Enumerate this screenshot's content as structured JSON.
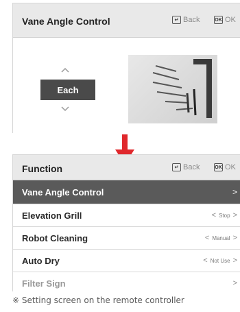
{
  "top_screen": {
    "title": "Vane Angle Control",
    "back_label": "Back",
    "ok_label": "OK",
    "back_key_glyph": "↵",
    "ok_key_glyph": "OK",
    "selector_value": "Each",
    "up_icon": "chevron-up-icon",
    "down_icon": "chevron-down-icon"
  },
  "arrow_color": "#e0282c",
  "bottom_screen": {
    "title": "Function",
    "back_label": "Back",
    "ok_label": "OK",
    "back_key_glyph": "↵",
    "ok_key_glyph": "OK",
    "items": [
      {
        "label": "Vane Angle Control",
        "value": "",
        "active": true
      },
      {
        "label": "Elevation Grill",
        "value": "Stop"
      },
      {
        "label": "Robot Cleaning",
        "value": "Manual"
      },
      {
        "label": "Auto Dry",
        "value": "Not Use"
      },
      {
        "label": "Filter Sign",
        "value": ""
      }
    ]
  },
  "footnote": "※ Setting screen on the remote controller"
}
